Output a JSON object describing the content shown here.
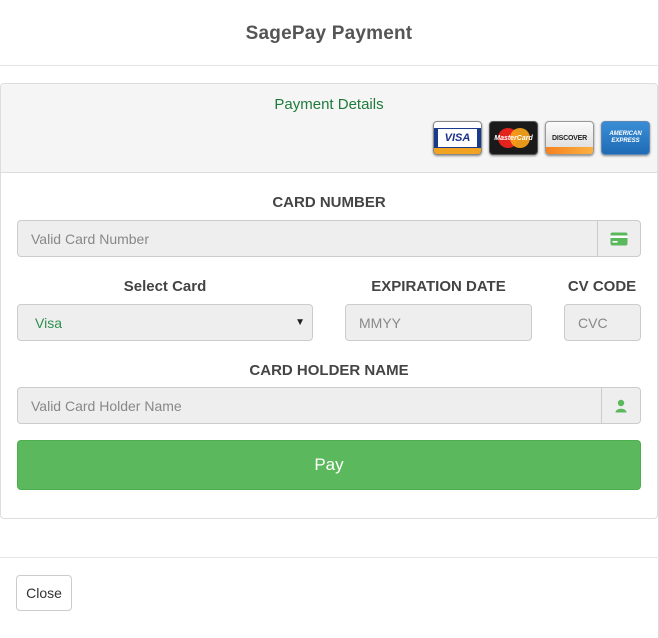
{
  "modal": {
    "title": "SagePay Payment"
  },
  "panel": {
    "title": "Payment Details"
  },
  "card_logos": [
    {
      "icon": "visa-logo",
      "text": "VISA"
    },
    {
      "icon": "mastercard-logo",
      "text": "MasterCard"
    },
    {
      "icon": "discover-logo",
      "text": "DISCOVER"
    },
    {
      "icon": "amex-logo",
      "text": "AMERICAN EXPRESS"
    }
  ],
  "form": {
    "card_number_label": "CARD NUMBER",
    "card_number_placeholder": "Valid Card Number",
    "card_number_icon": "credit-card-icon",
    "select_card_label": "Select Card",
    "select_card_value": "Visa",
    "expiration_label": "EXPIRATION DATE",
    "expiration_placeholder": "MMYY",
    "cvc_label": "CV CODE",
    "cvc_placeholder": "CVC",
    "holder_label": "CARD HOLDER NAME",
    "holder_placeholder": "Valid Card Holder Name",
    "holder_icon": "user-icon",
    "pay_label": "Pay"
  },
  "footer": {
    "close_label": "Close"
  },
  "colors": {
    "pay_button": "#5cb85c",
    "panel_title": "#1f7a3c",
    "select_value": "#2f8f4f"
  }
}
